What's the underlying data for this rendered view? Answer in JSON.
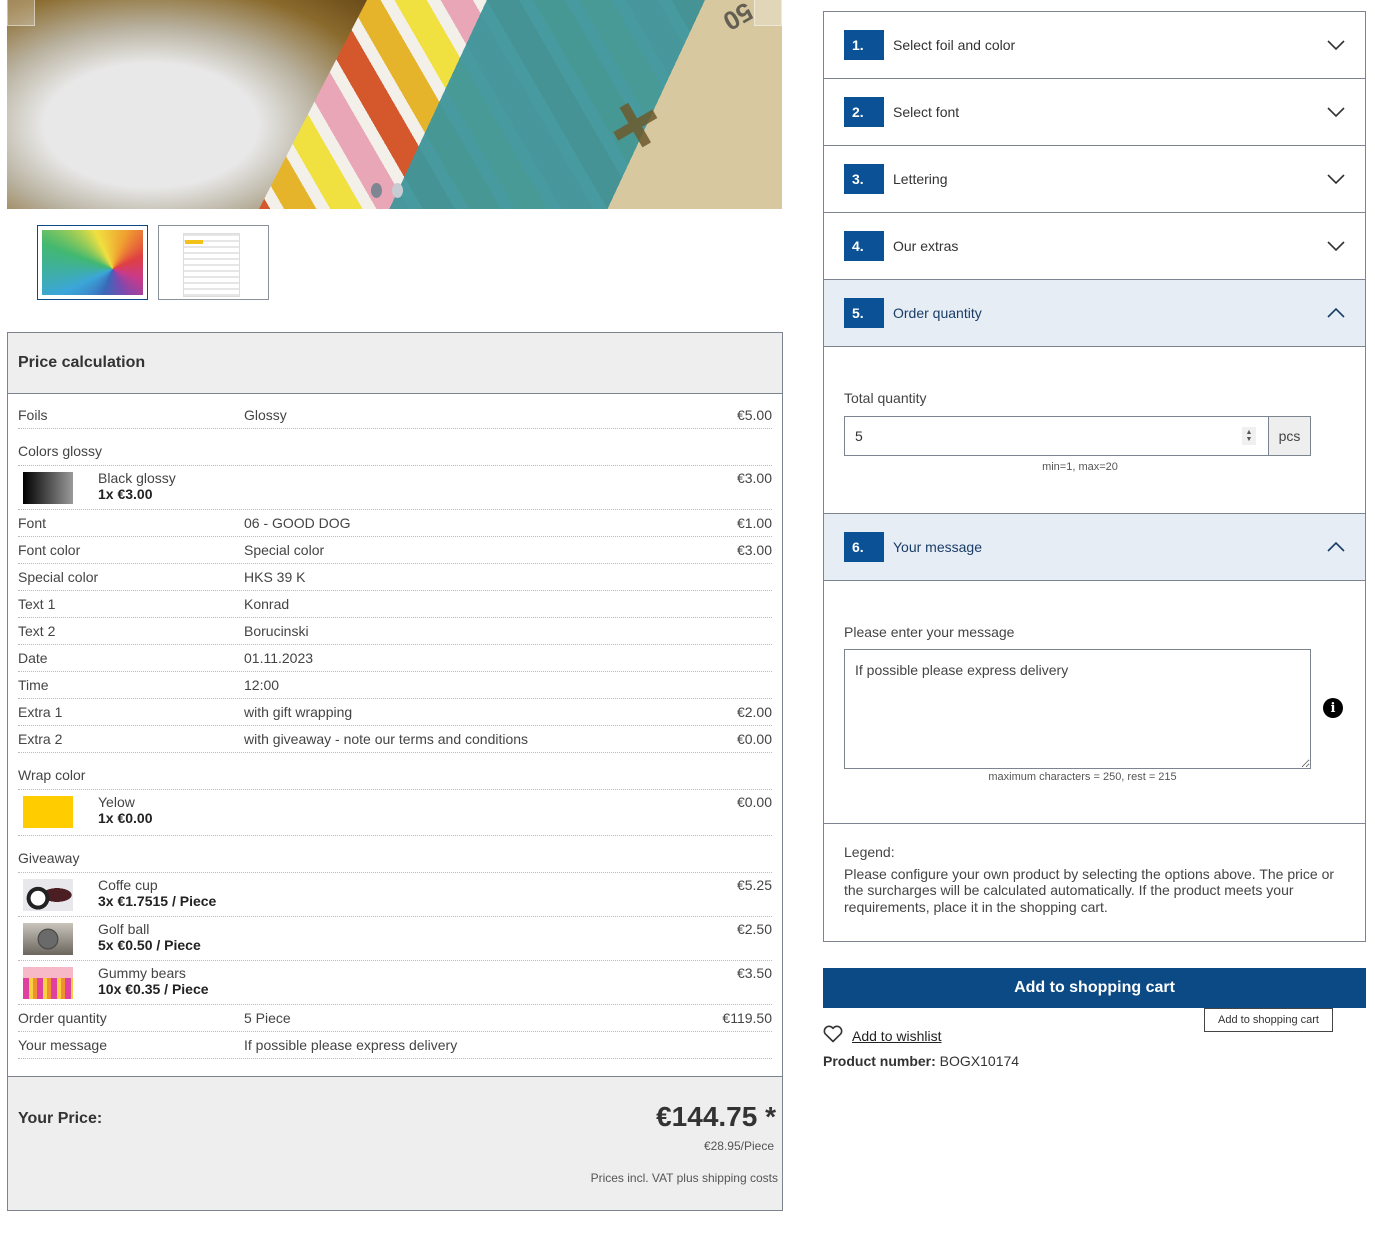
{
  "gallery": {
    "prev_label": "‹",
    "next_label": "›",
    "slide_count": 2,
    "active_slide": 1,
    "thumbnails": [
      {
        "alt": "color fan swatch book",
        "active": true
      },
      {
        "alt": "product configurator screenshot",
        "active": false
      }
    ]
  },
  "price_calculation": {
    "title": "Price calculation",
    "rows": {
      "foils": {
        "label": "Foils",
        "value": "Glossy",
        "price": "€5.00"
      },
      "colors_glossy": {
        "label": "Colors glossy"
      },
      "black_glossy": {
        "name": "Black glossy",
        "qty": "1x €3.00",
        "price": "€3.00"
      },
      "font": {
        "label": "Font",
        "value": "06 - GOOD DOG",
        "price": "€1.00"
      },
      "font_color": {
        "label": "Font color",
        "value": "Special color",
        "price": "€3.00"
      },
      "special_color": {
        "label": "Special color",
        "value": "HKS 39 K",
        "price": ""
      },
      "text1": {
        "label": "Text 1",
        "value": "Konrad",
        "price": ""
      },
      "text2": {
        "label": "Text 2",
        "value": "Borucinski",
        "price": ""
      },
      "date": {
        "label": "Date",
        "value": "01.11.2023",
        "price": ""
      },
      "time": {
        "label": "Time",
        "value": "12:00",
        "price": ""
      },
      "extra1": {
        "label": "Extra 1",
        "value": "with gift wrapping",
        "price": "€2.00"
      },
      "extra2": {
        "label": "Extra 2",
        "value": "with giveaway - note our terms and conditions",
        "price": "€0.00"
      },
      "wrap_color": {
        "label": "Wrap color"
      },
      "yelow": {
        "name": "Yelow",
        "qty": "1x €0.00",
        "price": "€0.00",
        "color": "#ffcc00"
      },
      "giveaway": {
        "label": "Giveaway"
      },
      "coffee_cup": {
        "name": "Coffe cup",
        "qty": "3x €1.7515 / Piece",
        "price": "€5.25"
      },
      "golf_ball": {
        "name": "Golf ball",
        "qty": "5x €0.50 / Piece",
        "price": "€2.50"
      },
      "gummy_bears": {
        "name": "Gummy bears",
        "qty": "10x €0.35 / Piece",
        "price": "€3.50"
      },
      "order_quantity": {
        "label": "Order quantity",
        "value": "5 Piece",
        "price": "€119.50"
      },
      "your_message": {
        "label": "Your message",
        "value": "If possible please express delivery",
        "price": ""
      }
    },
    "total": {
      "label": "Your Price:",
      "value": "€144.75 *",
      "per_piece": "€28.95/Piece",
      "vat_note": "Prices incl. VAT plus shipping costs"
    }
  },
  "configurator": {
    "steps": [
      {
        "number": "1.",
        "title": "Select foil and color",
        "open": false
      },
      {
        "number": "2.",
        "title": "Select font",
        "open": false
      },
      {
        "number": "3.",
        "title": "Lettering",
        "open": false
      },
      {
        "number": "4.",
        "title": "Our extras",
        "open": false
      },
      {
        "number": "5.",
        "title": "Order quantity",
        "open": true
      },
      {
        "number": "6.",
        "title": "Your message",
        "open": true
      }
    ],
    "quantity": {
      "label": "Total quantity",
      "value": "5",
      "unit": "pcs",
      "hint": "min=1, max=20"
    },
    "message": {
      "label": "Please enter your message",
      "value": "If possible please express delivery",
      "hint": "maximum characters = 250, rest = 215"
    },
    "legend": {
      "title": "Legend:",
      "text": "Please configure your own product by selecting the options above. The price or the surcharges will be calculated automatically. If the product meets your requirements, place it in the shopping cart."
    }
  },
  "actions": {
    "add_to_cart": "Add to shopping cart",
    "add_to_cart_tooltip": "Add to shopping cart",
    "wishlist": "Add to wishlist"
  },
  "product": {
    "number_label": "Product number:",
    "number_value": "BOGX10174"
  },
  "colors": {
    "primary": "#0b4a85",
    "step_badge": "#0b5195",
    "open_step_bg": "#e6edf5"
  }
}
